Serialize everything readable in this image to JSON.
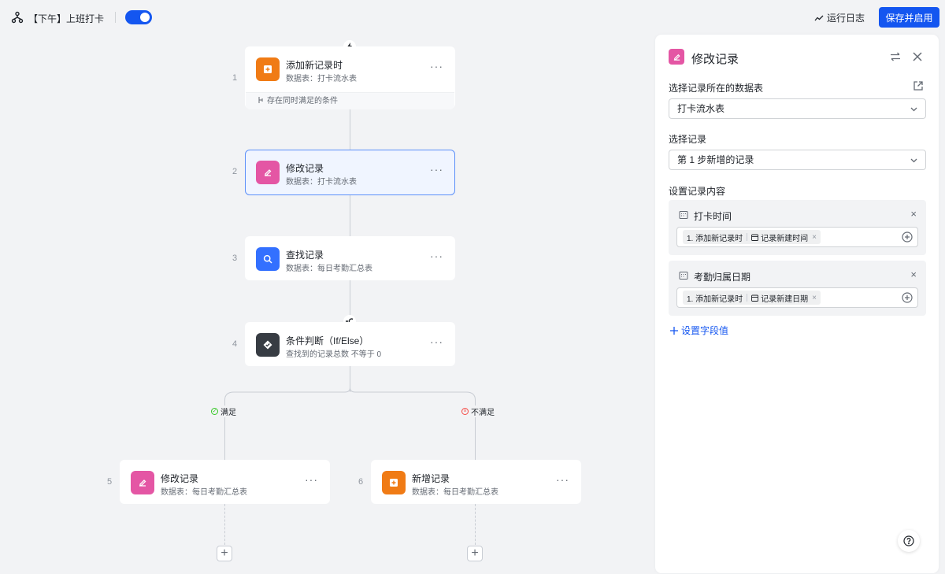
{
  "header": {
    "title": "【下午】上班打卡",
    "toggle_on": true,
    "run_log": "运行日志",
    "save_label": "保存并启用"
  },
  "colors": {
    "primary": "#1456f0",
    "orange": "#f07b15",
    "pink": "#e456a4",
    "blue": "#3370ff",
    "dark": "#373c43"
  },
  "nodes": [
    {
      "num": "1",
      "title": "添加新记录时",
      "subtitle": "数据表：打卡流水表",
      "footer": "存在同时满足的条件",
      "icon": "add-record-icon"
    },
    {
      "num": "2",
      "title": "修改记录",
      "subtitle": "数据表：打卡流水表",
      "icon": "edit-icon"
    },
    {
      "num": "3",
      "title": "查找记录",
      "subtitle": "数据表：每日考勤汇总表",
      "icon": "search-icon"
    },
    {
      "num": "4",
      "title": "条件判断（If/Else）",
      "subtitle": "查找到的记录总数 不等于 0",
      "icon": "condition-icon"
    },
    {
      "num": "5",
      "title": "修改记录",
      "subtitle": "数据表：每日考勤汇总表",
      "icon": "edit-icon"
    },
    {
      "num": "6",
      "title": "新增记录",
      "subtitle": "数据表：每日考勤汇总表",
      "icon": "add-record-icon"
    }
  ],
  "more": "···",
  "branches": {
    "yes": "满足",
    "no": "不满足"
  },
  "panel": {
    "title": "修改记录",
    "table_label": "选择记录所在的数据表",
    "table_value": "打卡流水表",
    "record_label": "选择记录",
    "record_value": "第 1 步新增的记录",
    "content_label": "设置记录内容",
    "fields": [
      {
        "name": "打卡时间",
        "tag_step": "1. 添加新记录时",
        "tag_field": "记录新建时间"
      },
      {
        "name": "考勤归属日期",
        "tag_step": "1. 添加新记录时",
        "tag_field": "记录新建日期"
      }
    ],
    "add_field": "设置字段值"
  }
}
